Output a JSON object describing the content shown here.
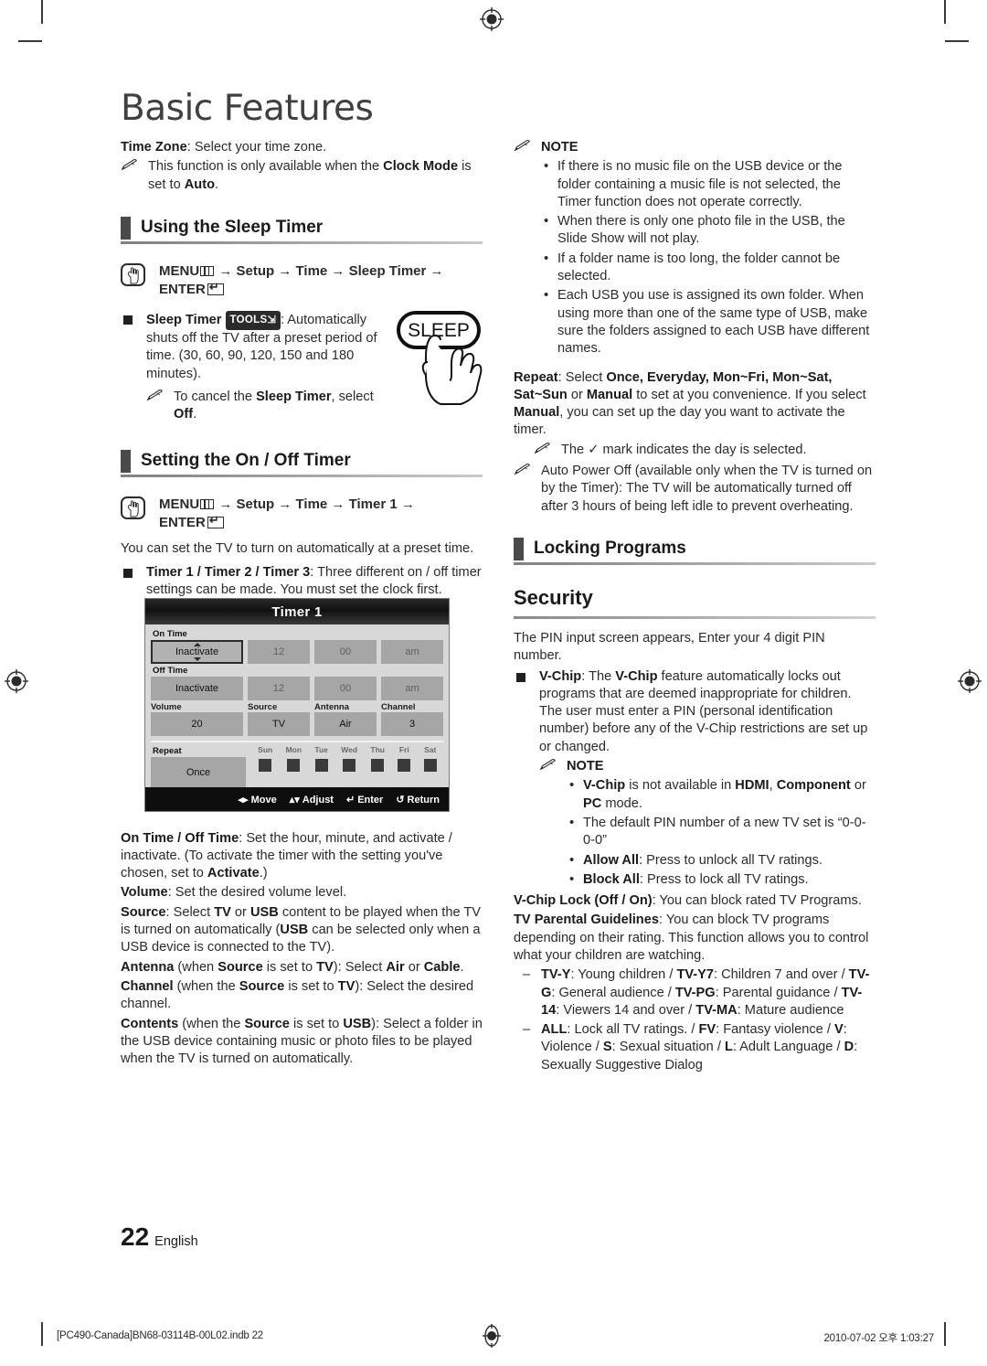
{
  "page": {
    "title": "Basic Features",
    "number": "22",
    "language": "English"
  },
  "footer": {
    "left": "[PC490-Canada]BN68-03114B-00L02.indb   22",
    "right": "2010-07-02   오후 1:03:27"
  },
  "left_column": {
    "time_zone": {
      "label": "Time Zone",
      "text": ": Select your time zone.",
      "note": {
        "text_a": "This function is only available when the ",
        "bold_a": "Clock Mode",
        "text_b": " is set to ",
        "bold_b": "Auto",
        "text_c": "."
      }
    },
    "section_sleep": {
      "heading": "Using the Sleep Timer",
      "menu_path": {
        "menu": "MENU",
        "steps": " → Setup → Time → Sleep Timer →",
        "enter": "ENTER"
      },
      "bullet": {
        "bold": "Sleep Timer",
        "tools": "TOOLS",
        "text": ": Automatically shuts off the TV after a preset period of time. (30, 60, 90, 120, 150 and 180 minutes)."
      },
      "note": {
        "text_a": "To cancel the ",
        "bold_a": "Sleep Timer",
        "text_b": ", select ",
        "bold_b": "Off",
        "text_c": "."
      },
      "remote_button": "SLEEP"
    },
    "section_onoff": {
      "heading": "Setting the On / Off Timer",
      "menu_path": {
        "menu": "MENU",
        "steps": " → Setup → Time → Timer 1 →",
        "enter": "ENTER"
      },
      "intro": "You can set the TV to turn on automatically at a preset time.",
      "bullet": {
        "bold": "Timer 1 / Timer 2 / Timer 3",
        "text": ": Three different on / off timer settings can be made. You must set the clock first."
      }
    },
    "descriptions": [
      {
        "bold": "On Time / Off Time",
        "text": ": Set the hour, minute, and activate / inactivate. (To activate the timer with the setting you've chosen, set to ",
        "bold2": "Activate",
        "text2": ".)"
      },
      {
        "bold": "Volume",
        "text": ": Set the desired volume level."
      },
      {
        "bold": "Source",
        "text": ": Select TV or USB content to be played when the TV is turned on automatically (USB can be selected only when a USB device is connected to the TV)."
      },
      {
        "bold": "Antenna",
        "text": " (when Source is set to TV): Select Air or Cable."
      },
      {
        "bold": "Channel",
        "text": " (when the Source is set to TV): Select the desired channel."
      },
      {
        "bold": "Contents",
        "text": " (when the Source is set to USB): Select a folder in the USB device containing music or photo files to be played when the TV is turned on automatically."
      }
    ]
  },
  "osd": {
    "title": "Timer 1",
    "on_time_label": "On Time",
    "off_time_label": "Off Time",
    "on_time": {
      "state": "Inactivate",
      "hour": "12",
      "minute": "00",
      "meridiem": "am"
    },
    "off_time": {
      "state": "Inactivate",
      "hour": "12",
      "minute": "00",
      "meridiem": "am"
    },
    "quad_headers": [
      "Volume",
      "Source",
      "Antenna",
      "Channel"
    ],
    "quad_values": [
      "20",
      "TV",
      "Air",
      "3"
    ],
    "repeat_label": "Repeat",
    "repeat_value": "Once",
    "days": [
      "Sun",
      "Mon",
      "Tue",
      "Wed",
      "Thu",
      "Fri",
      "Sat"
    ],
    "footer_actions": [
      "Move",
      "Adjust",
      "Enter",
      "Return"
    ]
  },
  "right_column": {
    "note_heading": "NOTE",
    "usb_notes": [
      "If there is no music file on the USB device or the folder containing a music file is not selected, the Timer function does not operate correctly.",
      "When there is only one photo file in the USB, the Slide Show will not play.",
      "If a folder name is too long, the folder cannot be selected.",
      "Each USB you use is assigned its own folder. When using more than one of the same type of USB, make sure the folders assigned to each USB have different names."
    ],
    "repeat": {
      "bold": "Repeat",
      "text": ": Select Once, Everyday, Mon~Fri, Mon~Sat, Sat~Sun or Manual to set at you convenience. If you select Manual, you can set up the day you want to activate the timer.",
      "note": "The ✓ mark indicates the day is selected."
    },
    "auto_power_off": "Auto Power Off (available only when the TV is turned on by the Timer): The TV will be automatically turned off after 3 hours of being left idle to prevent overheating.",
    "section_locking": {
      "heading": "Locking Programs"
    },
    "security": {
      "heading": "Security",
      "intro": "The PIN input screen appears, Enter your 4 digit PIN number.",
      "vchip": {
        "bold": "V-Chip",
        "text": ": The V-Chip feature automatically locks out programs that are deemed inappropriate for children. The user must enter a PIN (personal identification number) before any of the V-Chip restrictions are set up or changed."
      },
      "note_heading": "NOTE",
      "notes": [
        "V-Chip is not available in HDMI, Component or PC mode.",
        "The default PIN number of a new TV set is “0-0-0-0”",
        "Allow All: Press to unlock all TV ratings.",
        "Block All: Press to lock all TV ratings."
      ],
      "vchip_lock": {
        "bold": "V-Chip Lock (Off / On)",
        "text": ": You can block rated TV Programs."
      },
      "parental": {
        "bold": "TV Parental Guidelines",
        "text": ": You can block TV programs depending on their rating. This function allows you to control what your children are watching."
      },
      "ratings": [
        "TV-Y: Young children / TV-Y7: Children 7 and over / TV-G: General audience / TV-PG: Parental guidance / TV-14: Viewers 14 and over / TV-MA: Mature audience",
        "ALL: Lock all TV ratings. / FV: Fantasy violence / V: Violence / S: Sexual situation / L: Adult Language / D: Sexually Suggestive Dialog"
      ]
    }
  }
}
